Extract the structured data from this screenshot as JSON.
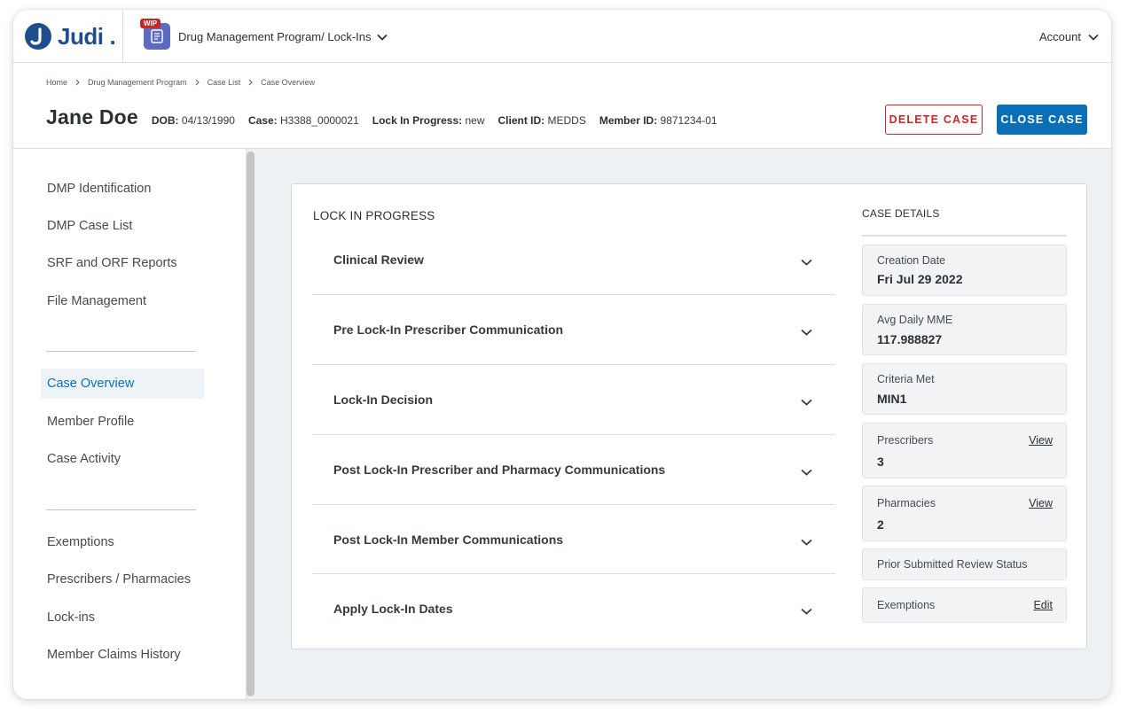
{
  "app": {
    "logo_text": "Judi",
    "wip_badge": "WIP",
    "program_selector": "Drug Management Program/ Lock-Ins",
    "account": "Account"
  },
  "breadcrumb": [
    "Home",
    "Drug Management Program",
    "Case List",
    "Case Overview"
  ],
  "case": {
    "name": "Jane Doe",
    "dob_label": "DOB:",
    "dob": "04/13/1990",
    "case_label": "Case:",
    "case_id": "H3388_0000021",
    "lock_label": "Lock In Progress:",
    "lock_status": "new",
    "client_label": "Client ID:",
    "client_id": "MEDDS",
    "member_label": "Member ID:",
    "member_id": "9871234-01"
  },
  "actions": {
    "delete": "DELETE CASE",
    "close": "CLOSE CASE"
  },
  "sidebar": {
    "group1": [
      "DMP Identification",
      "DMP Case List",
      "SRF and ORF Reports",
      "File Management"
    ],
    "group2": [
      "Case Overview",
      "Member Profile",
      "Case Activity"
    ],
    "group3": [
      "Exemptions",
      "Prescribers / Pharmacies",
      "Lock-ins",
      "Member Claims History"
    ],
    "active": "Case Overview"
  },
  "lock_in_progress": {
    "title": "LOCK IN PROGRESS",
    "sections": [
      "Clinical Review",
      "Pre Lock-In Prescriber Communication",
      "Lock-In Decision",
      "Post Lock-In Prescriber and Pharmacy Communications",
      "Post Lock-In Member Communications",
      "Apply Lock-In Dates"
    ]
  },
  "case_details": {
    "title": "CASE DETAILS",
    "creation_date_label": "Creation Date",
    "creation_date": "Fri Jul 29 2022",
    "avg_mme_label": "Avg Daily MME",
    "avg_mme": "117.988827",
    "criteria_label": "Criteria Met",
    "criteria": "MIN1",
    "prescribers_label": "Prescribers",
    "prescribers": "3",
    "prescribers_link": "View",
    "pharmacies_label": "Pharmacies",
    "pharmacies": "2",
    "pharmacies_link": "View",
    "prior_review_label": "Prior Submitted Review Status",
    "exemptions_label": "Exemptions",
    "exemptions_link": "Edit"
  },
  "colors": {
    "brand": "#1e4e8c",
    "primary": "#0b6fb8",
    "danger": "#c62828",
    "program_icon": "#5c6bc0"
  }
}
